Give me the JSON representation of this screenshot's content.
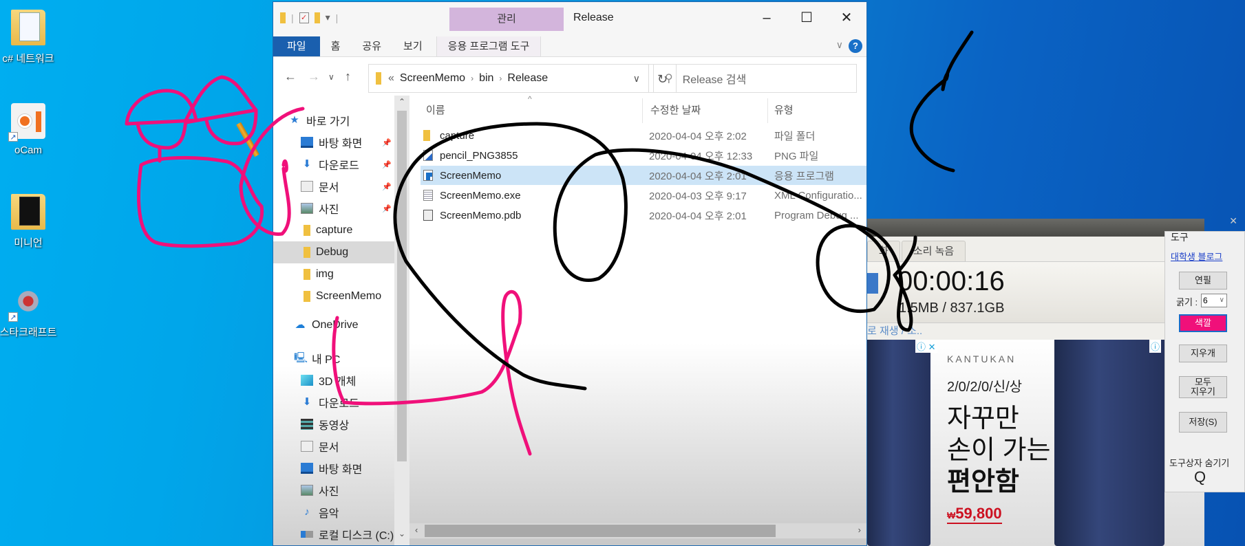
{
  "desktop": {
    "icons": [
      {
        "label": "c# 네트워크",
        "icon": "folder-document-icon"
      },
      {
        "label": "oCam",
        "icon": "ocam-app-icon"
      },
      {
        "label": "미니언",
        "icon": "folder-icon"
      },
      {
        "label": "스타크래프트",
        "icon": "starcraft-game-icon"
      }
    ]
  },
  "explorer": {
    "title": "Release",
    "context_tab": "관리",
    "window_controls": {
      "minimize": "–",
      "maximize": "☐",
      "close": "✕"
    },
    "ribbon_tabs": [
      "파일",
      "홈",
      "공유",
      "보기",
      "응용 프로그램 도구"
    ],
    "address": {
      "prefix": "«",
      "segments": [
        "ScreenMemo",
        "bin",
        "Release"
      ],
      "separator": "›"
    },
    "search_placeholder": "Release 검색",
    "nav_pane": [
      {
        "label": "바로 가기",
        "icon": "star-icon",
        "pinned": false
      },
      {
        "label": "바탕 화면",
        "icon": "desktop-icon",
        "pinned": true
      },
      {
        "label": "다운로드",
        "icon": "download-icon",
        "pinned": true
      },
      {
        "label": "문서",
        "icon": "document-icon",
        "pinned": true
      },
      {
        "label": "사진",
        "icon": "pictures-icon",
        "pinned": true
      },
      {
        "label": "capture",
        "icon": "folder-icon",
        "pinned": false
      },
      {
        "label": "Debug",
        "icon": "folder-icon",
        "pinned": false,
        "selected": true
      },
      {
        "label": "img",
        "icon": "folder-icon",
        "pinned": false
      },
      {
        "label": "ScreenMemo",
        "icon": "folder-icon",
        "pinned": false
      },
      {
        "label": "OneDrive",
        "icon": "cloud-icon",
        "pinned": false
      },
      {
        "label": "내 PC",
        "icon": "pc-icon",
        "pinned": false
      },
      {
        "label": "3D 개체",
        "icon": "3d-objects-icon",
        "pinned": false
      },
      {
        "label": "다운로드",
        "icon": "download-icon",
        "pinned": false
      },
      {
        "label": "동영상",
        "icon": "video-icon",
        "pinned": false
      },
      {
        "label": "문서",
        "icon": "document-icon",
        "pinned": false
      },
      {
        "label": "바탕 화면",
        "icon": "desktop-icon",
        "pinned": false
      },
      {
        "label": "사진",
        "icon": "pictures-icon",
        "pinned": false
      },
      {
        "label": "음악",
        "icon": "music-icon",
        "pinned": false
      },
      {
        "label": "로컬 디스크 (C:)",
        "icon": "disk-icon",
        "pinned": false
      }
    ],
    "columns": {
      "name": "이름",
      "date": "수정한 날짜",
      "type": "유형"
    },
    "files": [
      {
        "name": "capture",
        "date": "2020-04-04 오후 2:02",
        "type": "파일 폴더",
        "icon": "folder-icon"
      },
      {
        "name": "pencil_PNG3855",
        "date": "2020-04-04 오후 12:33",
        "type": "PNG 파일",
        "icon": "png-file-icon"
      },
      {
        "name": "ScreenMemo",
        "date": "2020-04-04 오후 2:01",
        "type": "응용 프로그램",
        "icon": "application-icon",
        "selected": true
      },
      {
        "name": "ScreenMemo.exe",
        "date": "2020-04-03 오후 9:17",
        "type": "XML Configuratio...",
        "icon": "xml-config-icon"
      },
      {
        "name": "ScreenMemo.pdb",
        "date": "2020-04-04 오후 2:01",
        "type": "Program Debug ...",
        "icon": "pdb-file-icon"
      }
    ]
  },
  "recorder": {
    "tabs": [
      "화",
      "소리 녹음"
    ],
    "elapsed": "00:00:16",
    "size": "1.5MB / 837.1GB",
    "link_text": "로 재생 / 소..",
    "ad": {
      "brand": "KANTUKAN",
      "tagline": "2/0/2/0/신/상",
      "headline_1": "자꾸만",
      "headline_2": "손이 가는",
      "headline_3": "편안함",
      "currency": "₩",
      "price": "59,800",
      "adchoices": "ⓘ",
      "close": "✕"
    }
  },
  "tools": {
    "title": "도구",
    "blog_link": "대학생 블로그",
    "pencil_button": "연필",
    "thickness_label": "굵기 :",
    "thickness_value": "6",
    "color_button": "색깔",
    "color_value": "#f0107a",
    "eraser_button": "지우개",
    "clear_all_button_1": "모두",
    "clear_all_button_2": "지우기",
    "save_button": "저장(S)",
    "hide_label": "도구상자 숨기기",
    "hide_icon": "Q"
  },
  "drawing": {
    "pen_colors": [
      "#f0107a",
      "#000000"
    ]
  }
}
